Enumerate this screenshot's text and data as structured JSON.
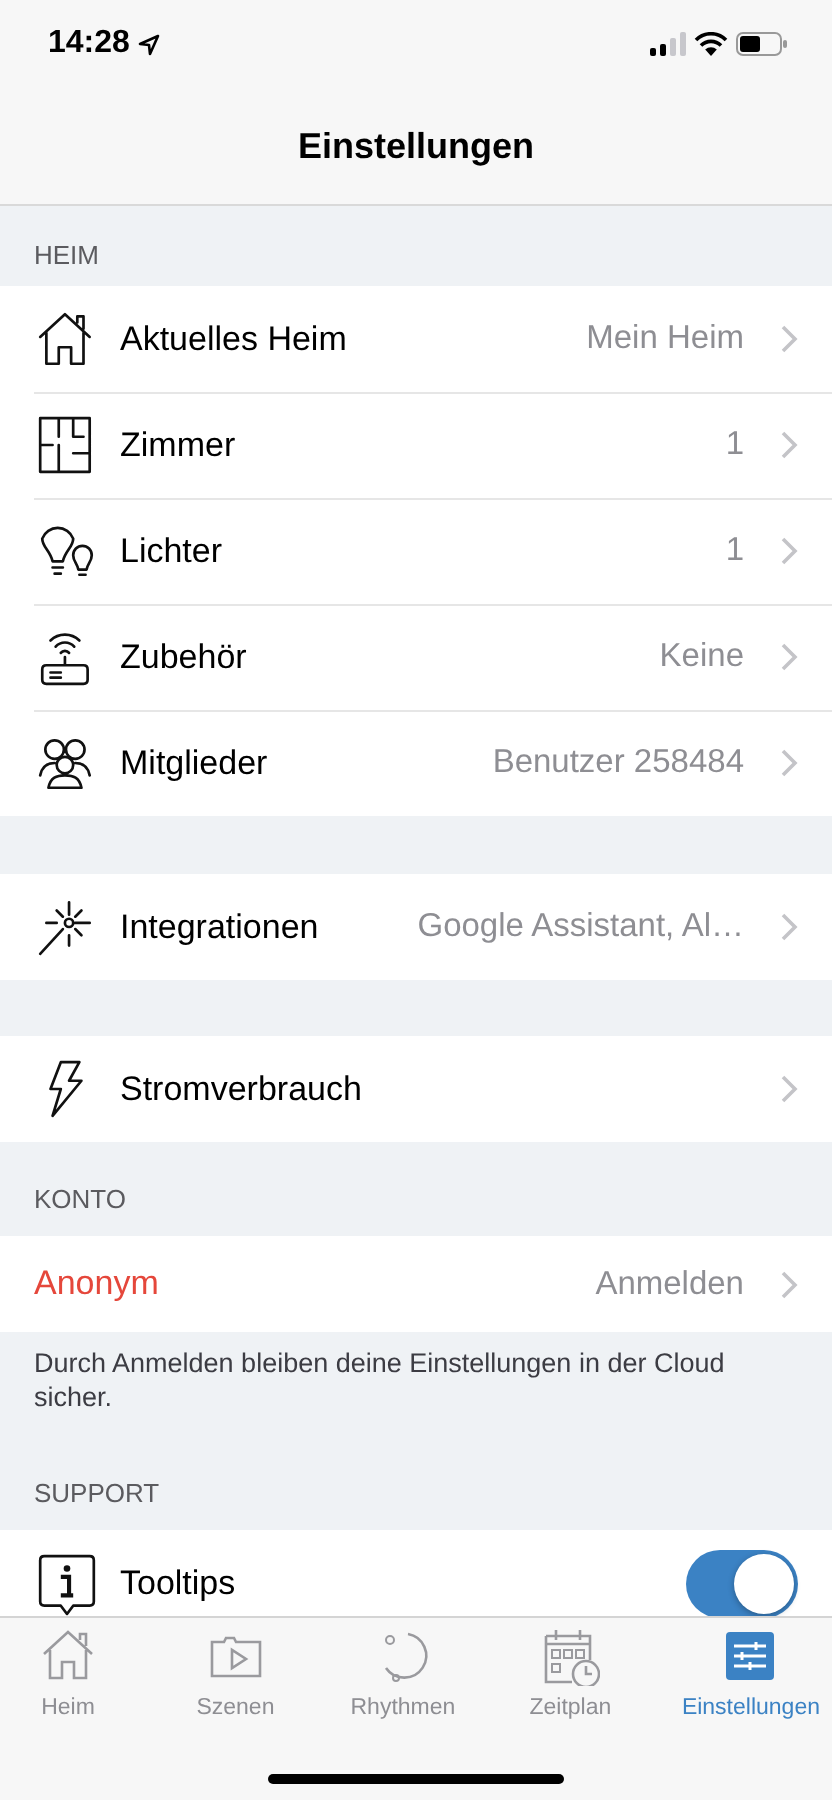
{
  "status_bar": {
    "time": "14:28"
  },
  "nav": {
    "title": "Einstellungen"
  },
  "sections": [
    {
      "header": "HEIM",
      "rows": [
        {
          "kind": "link",
          "label": "Aktuelles Heim",
          "value": "Mein Heim"
        },
        {
          "kind": "link",
          "label": "Zimmer",
          "value": "1"
        },
        {
          "kind": "link",
          "label": "Lichter",
          "value": "1"
        },
        {
          "kind": "link",
          "label": "Zubehör",
          "value": "Keine"
        },
        {
          "kind": "link",
          "label": "Mitglieder",
          "value": "Benutzer 258484"
        }
      ]
    },
    {
      "rows": [
        {
          "kind": "link",
          "label": "Integrationen",
          "value": "Google Assistant, Al…"
        }
      ]
    },
    {
      "rows": [
        {
          "kind": "link",
          "label": "Stromverbrauch"
        }
      ]
    },
    {
      "header": "KONTO",
      "rows": [
        {
          "kind": "account",
          "label": "Anonym",
          "value": "Anmelden"
        }
      ],
      "footer": "Durch Anmelden bleiben deine Einstellungen in der Cloud sicher."
    },
    {
      "header": "SUPPORT",
      "rows": [
        {
          "kind": "toggle",
          "label": "Tooltips",
          "on": true
        }
      ]
    }
  ],
  "tabs": [
    {
      "label": "Heim",
      "selected": false
    },
    {
      "label": "Szenen",
      "selected": false
    },
    {
      "label": "Rhythmen",
      "selected": false
    },
    {
      "label": "Zeitplan",
      "selected": false
    },
    {
      "label": "Einstellungen",
      "selected": true
    }
  ]
}
